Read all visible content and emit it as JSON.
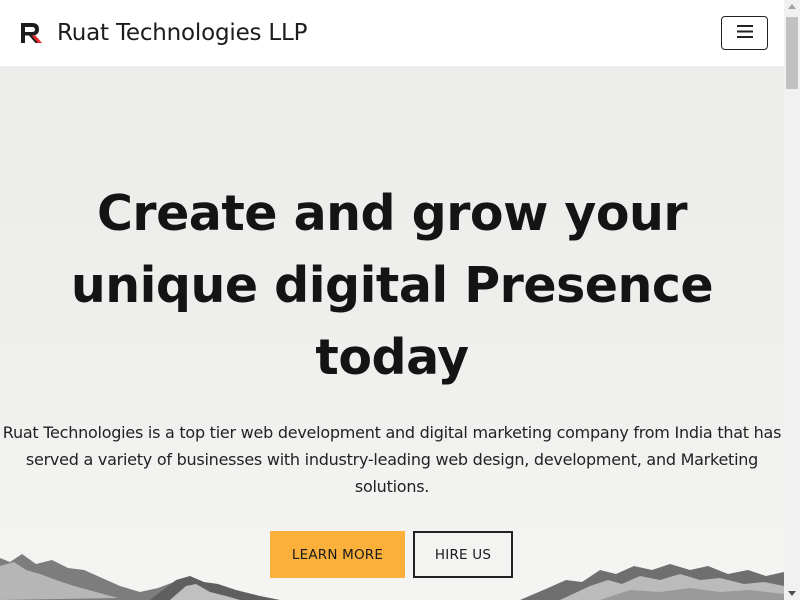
{
  "navbar": {
    "brand_name": "Ruat Technologies LLP",
    "logo_icon": "ruat-r-logo",
    "menu_icon": "hamburger-menu-icon"
  },
  "hero": {
    "title": "Create and grow your unique digital Presence today",
    "description": "Ruat Technologies is a top tier web development and digital marketing company from India that has served a variety of businesses with industry-leading web design, development, and Marketing solutions.",
    "primary_button_label": "LEARN MORE",
    "secondary_button_label": "HIRE US"
  },
  "colors": {
    "accent": "#fbb03b",
    "logo_red": "#e8282d",
    "text_dark": "#141414"
  }
}
